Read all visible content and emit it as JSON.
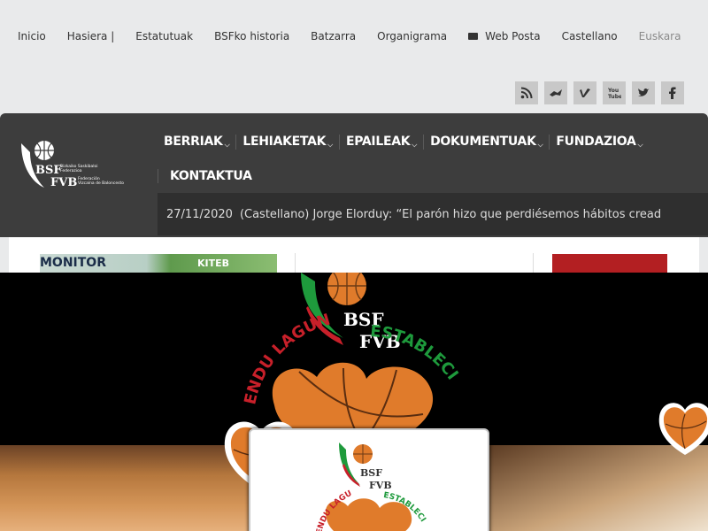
{
  "top_links": {
    "inicio": "Inicio",
    "hasiera": "Hasiera |",
    "estatutuak": "Estatutuak",
    "historia": "BSFko historia",
    "batzarra": "Batzarra",
    "organigrama": "Organigrama",
    "web_posta": "Web Posta",
    "castellano": "Castellano",
    "euskara": "Euskara"
  },
  "social": [
    "rss-icon",
    "delicious-icon",
    "vimeo-icon",
    "youtube-icon",
    "twitter-icon",
    "facebook-icon"
  ],
  "logo": {
    "line1": "BSF",
    "line2": "FVB",
    "sub1": "Bizkaiko Saskibaloi",
    "sub2": "Federazioa",
    "sub3": "Federación",
    "sub4": "Vizcaína de Baloncesto"
  },
  "nav": [
    {
      "label": "BERRIAK",
      "has_caret": true
    },
    {
      "label": "LEHIAKETAK",
      "has_caret": true
    },
    {
      "label": "EPAILEAK",
      "has_caret": true
    },
    {
      "label": "DOKUMENTUAK",
      "has_caret": true
    },
    {
      "label": "FUNDAZIOA",
      "has_caret": true
    },
    {
      "label": "KONTAKTUA",
      "has_caret": false
    }
  ],
  "ticker": {
    "date": "27/11/2020",
    "text": "(Castellano) Jorge Elorduy: “El parón hizo que perdiésemos hábitos cread"
  },
  "thumbs": {
    "monitor": "MONITOR",
    "kiteb": "KITEB"
  },
  "overlay": {
    "brand1": "BSF",
    "brand2": "FVB",
    "arc_left": "ENDU LAGUNA",
    "arc_right": "ESTABLECI",
    "card_arc_left": "ENDU LAGUNA",
    "card_arc_right": "ESTABLECI"
  },
  "colors": {
    "header": "#3d3d3d",
    "ticker": "#2f2f2f",
    "accent_red": "#b31f22",
    "green": "#1e9a3c",
    "ball_orange": "#e07b2b"
  }
}
